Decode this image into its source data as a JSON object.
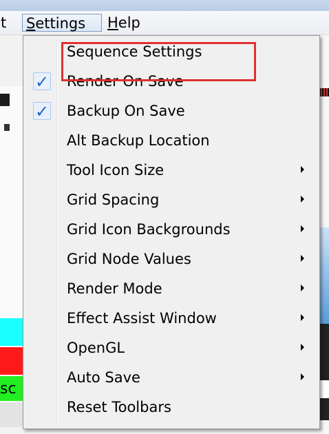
{
  "menubar": {
    "items": [
      {
        "label": "t"
      },
      {
        "label": "Settings",
        "accelerator": "S"
      },
      {
        "label": "Help",
        "accelerator": "H"
      }
    ]
  },
  "settings_menu": {
    "items": [
      {
        "label": "Sequence Settings",
        "checked": false,
        "submenu": false,
        "highlighted": true
      },
      {
        "label": "Render On Save",
        "checked": true,
        "submenu": false
      },
      {
        "label": "Backup On Save",
        "checked": true,
        "submenu": false
      },
      {
        "label": "Alt Backup Location",
        "checked": false,
        "submenu": false
      },
      {
        "label": "Tool Icon Size",
        "checked": false,
        "submenu": true
      },
      {
        "label": "Grid Spacing",
        "checked": false,
        "submenu": true
      },
      {
        "label": "Grid Icon Backgrounds",
        "checked": false,
        "submenu": true
      },
      {
        "label": "Grid Node Values",
        "checked": false,
        "submenu": true
      },
      {
        "label": "Render Mode",
        "checked": false,
        "submenu": true
      },
      {
        "label": "Effect Assist Window",
        "checked": false,
        "submenu": true
      },
      {
        "label": "OpenGL",
        "checked": false,
        "submenu": true
      },
      {
        "label": "Auto Save",
        "checked": false,
        "submenu": true
      },
      {
        "label": "Reset Toolbars",
        "checked": false,
        "submenu": false
      }
    ]
  },
  "glyphs": {
    "check": "✓"
  },
  "background": {
    "left_cell_text": "sc"
  },
  "colors": {
    "highlight_border": "#e03030",
    "check_mark": "#1e63c9",
    "cyan_cell": "#19ffff",
    "red_cell": "#ff1a1a",
    "green_cell": "#22ee22"
  }
}
